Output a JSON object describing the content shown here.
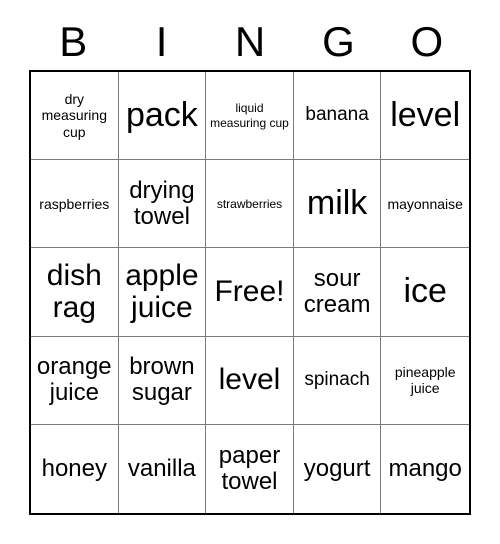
{
  "card": {
    "title": "BINGO",
    "free_space_label": "Free!",
    "border_color": "#000000",
    "grid_line_color": "#7a7a7a",
    "text_color": "#000000",
    "background_color": "#ffffff"
  },
  "header": {
    "letters": [
      "B",
      "I",
      "N",
      "G",
      "O"
    ]
  },
  "grid": {
    "columns": 5,
    "rows": 5,
    "cells": [
      {
        "text": "dry measuring cup",
        "size": "fs-sm"
      },
      {
        "text": "pack",
        "size": "fs-xxl"
      },
      {
        "text": "liquid measuring cup",
        "size": "fs-xs"
      },
      {
        "text": "banana",
        "size": "fs-md"
      },
      {
        "text": "level",
        "size": "fs-xxl"
      },
      {
        "text": "raspberries",
        "size": "fs-sm"
      },
      {
        "text": "drying towel",
        "size": "fs-lg"
      },
      {
        "text": "strawberries",
        "size": "fs-xs"
      },
      {
        "text": "milk",
        "size": "fs-xxl"
      },
      {
        "text": "mayonnaise",
        "size": "fs-sm"
      },
      {
        "text": "dish rag",
        "size": "fs-xl"
      },
      {
        "text": "apple juice",
        "size": "fs-xl"
      },
      {
        "text": "Free!",
        "size": "fs-xl"
      },
      {
        "text": "sour cream",
        "size": "fs-lg"
      },
      {
        "text": "ice",
        "size": "fs-xxl"
      },
      {
        "text": "orange juice",
        "size": "fs-lg"
      },
      {
        "text": "brown sugar",
        "size": "fs-lg"
      },
      {
        "text": "level",
        "size": "fs-xl"
      },
      {
        "text": "spinach",
        "size": "fs-md"
      },
      {
        "text": "pineapple juice",
        "size": "fs-sm"
      },
      {
        "text": "honey",
        "size": "fs-lg"
      },
      {
        "text": "vanilla",
        "size": "fs-lg"
      },
      {
        "text": "paper towel",
        "size": "fs-lg"
      },
      {
        "text": "yogurt",
        "size": "fs-lg"
      },
      {
        "text": "mango",
        "size": "fs-lg"
      }
    ]
  }
}
